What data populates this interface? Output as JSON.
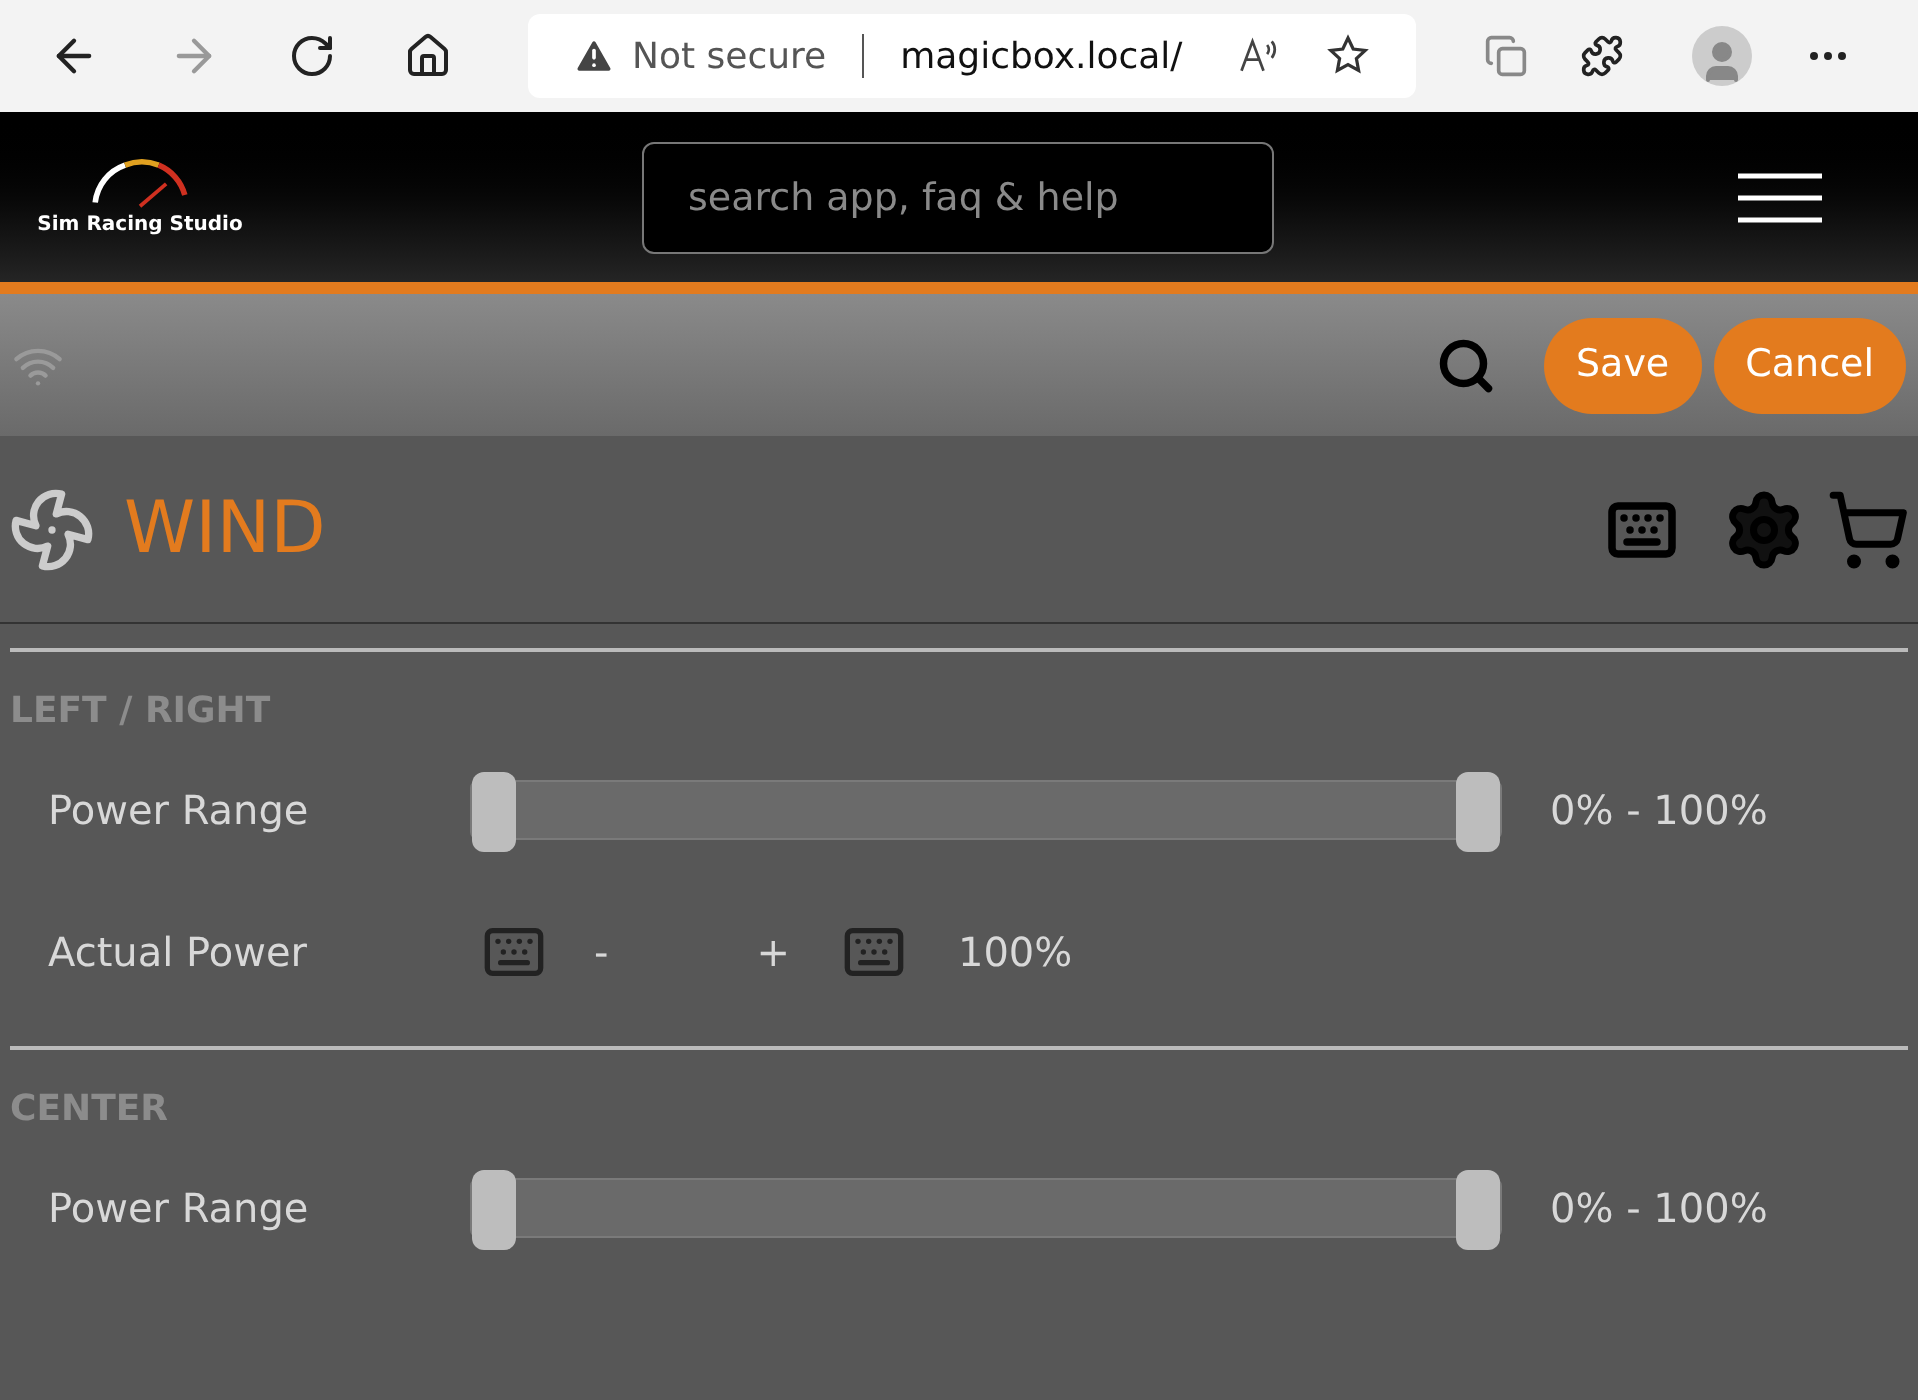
{
  "browser": {
    "security": "Not secure",
    "url": "magicbox.local/"
  },
  "header": {
    "logo_text": "Sim Racing Studio",
    "search": {
      "placeholder": "search app, faq & help"
    }
  },
  "toolbar": {
    "buttons": [
      "Save",
      "Cancel"
    ]
  },
  "page": {
    "title": "WIND"
  },
  "sections": [
    {
      "title": "LEFT / RIGHT",
      "rows": [
        {
          "kind": "range",
          "label": "Power Range",
          "low": {
            "level": 0
          },
          "high": {
            "level": 1
          },
          "reading": "0% - 100%"
        },
        {
          "kind": "power",
          "label": "Actual Power",
          "minus": "-",
          "plus": "+",
          "reading": "100%"
        }
      ]
    },
    {
      "title": "CENTER",
      "rows": [
        {
          "kind": "range",
          "label": "Power Range",
          "low": {
            "level": 0
          },
          "high": {
            "level": 1
          },
          "reading": "0% - 100%"
        }
      ]
    }
  ]
}
